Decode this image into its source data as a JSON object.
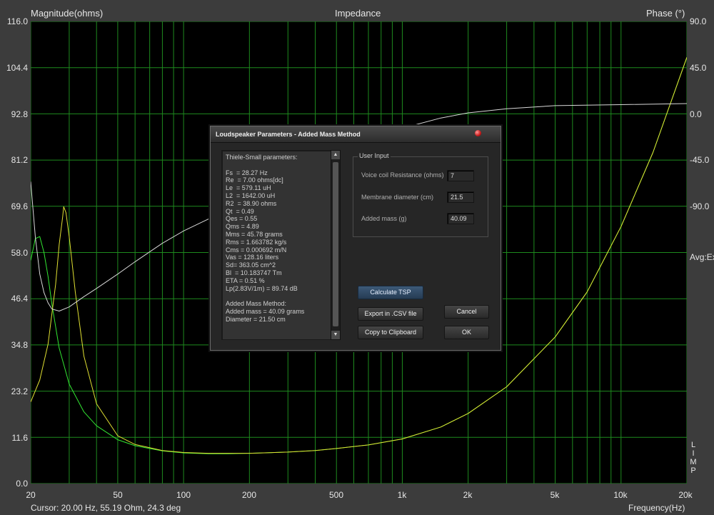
{
  "header": {
    "left_title": "Magnitude(ohms)",
    "center_title": "Impedance",
    "right_title": "Phase (°)"
  },
  "chart_data": {
    "type": "line",
    "title": "Impedance",
    "xlabel": "Frequency(Hz)",
    "ylabel": "Magnitude(ohms)",
    "y2label": "Phase (°)",
    "x_scale": "log",
    "xlim": [
      20,
      20000
    ],
    "ylim": [
      0,
      116
    ],
    "y2lim": [
      -135,
      90
    ],
    "grid": true,
    "background": "#000000",
    "grid_color": "#1e8a1e",
    "x_ticks": [
      "20",
      "50",
      "100",
      "200",
      "500",
      "1k",
      "2k",
      "5k",
      "10k",
      "20k"
    ],
    "y_ticks": [
      "116.0",
      "104.4",
      "92.8",
      "81.2",
      "69.6",
      "58.0",
      "46.4",
      "34.8",
      "23.2",
      "11.6",
      "0.0"
    ],
    "y2_ticks": [
      "90.0",
      "45.0",
      "0.0",
      "-45.0",
      "-90.0"
    ],
    "extra_label": "Avg:Ex",
    "side_label": "LIMP",
    "series": [
      {
        "color": "#32e632",
        "x": [
          20,
          21,
          22,
          23,
          24,
          25,
          27,
          30,
          35,
          40,
          50,
          60,
          80,
          100,
          130,
          160,
          200,
          300,
          400,
          500,
          700,
          1000,
          1500,
          2000,
          3000,
          5000,
          7000,
          10000,
          14000,
          20000
        ],
        "y": [
          56,
          61.5,
          62,
          58,
          52,
          45,
          34,
          25,
          18,
          14.5,
          11,
          9.5,
          8.2,
          7.7,
          7.5,
          7.5,
          7.6,
          7.9,
          8.3,
          8.8,
          9.7,
          11.2,
          14.2,
          17.6,
          24.3,
          36.8,
          48.1,
          64.5,
          83.1,
          107
        ]
      },
      {
        "color": "#e0e032",
        "x": [
          20,
          22,
          24,
          26,
          27,
          28,
          28.3,
          29,
          30,
          32,
          35,
          40,
          50,
          60,
          80,
          100,
          130,
          160,
          200,
          300,
          400,
          500,
          700,
          1000,
          1500,
          2000,
          3000,
          5000,
          7000,
          10000,
          14000,
          20000
        ],
        "y": [
          20.5,
          26,
          35,
          50,
          60,
          67,
          69.5,
          68,
          62,
          48,
          32,
          20,
          12,
          9.8,
          8.3,
          7.8,
          7.6,
          7.6,
          7.6,
          7.9,
          8.3,
          8.8,
          9.7,
          11.2,
          14.2,
          17.6,
          24.3,
          36.8,
          48.1,
          64.5,
          83.1,
          107
        ]
      },
      {
        "color": "#d8d8d8",
        "axis": "y2",
        "x": [
          20,
          21,
          22,
          23,
          24,
          25,
          27,
          30,
          35,
          40,
          50,
          60,
          80,
          100,
          150,
          200,
          300,
          500,
          700,
          1000,
          1500,
          2000,
          3000,
          5000,
          10000,
          20000
        ],
        "y": [
          12,
          -15,
          -33,
          -42,
          -47,
          -50,
          -51,
          -49,
          -44,
          -40,
          -33,
          -27,
          -18,
          -12,
          -3,
          4,
          14,
          26,
          33,
          38,
          43,
          45.5,
          47.5,
          49,
          49.5,
          50
        ]
      }
    ]
  },
  "dialog": {
    "title": "Loudspeaker Parameters - Added Mass Method",
    "params_lines": [
      "Thiele-Small parameters:",
      "",
      "Fs  = 28.27 Hz",
      "Re  = 7.00 ohms[dc]",
      "Le  = 579.11 uH",
      "L2  = 1642.00 uH",
      "R2  = 38.90 ohms",
      "Qt  = 0.49",
      "Qes = 0.55",
      "Qms = 4.89",
      "Mms = 45.78 grams",
      "Rms = 1.663782 kg/s",
      "Cms = 0.000692 m/N",
      "Vas = 128.16 liters",
      "Sd= 363.05 cm^2",
      "Bl  = 10.183747 Tm",
      "ETA = 0.51 %",
      "Lp(2.83V/1m) = 89.74 dB",
      "",
      "Added Mass Method:",
      "Added mass = 40.09 grams",
      "Diameter = 21.50 cm"
    ],
    "user_input": {
      "legend": "User Input",
      "fields": [
        {
          "label": "Voice coil Resistance (ohms)",
          "value": "7"
        },
        {
          "label": "Membrane diameter (cm)",
          "value": "21.5"
        },
        {
          "label": "Added mass (g)",
          "value": "40.09"
        }
      ]
    },
    "buttons": {
      "calculate": "Calculate TSP",
      "export": "Export in .CSV file",
      "copy": "Copy to Clipboard",
      "cancel": "Cancel",
      "ok": "OK"
    }
  },
  "footer": {
    "cursor": "Cursor: 20.00 Hz, 55.19 Ohm, 24.3 deg",
    "x_axis_label": "Frequency(Hz)"
  }
}
